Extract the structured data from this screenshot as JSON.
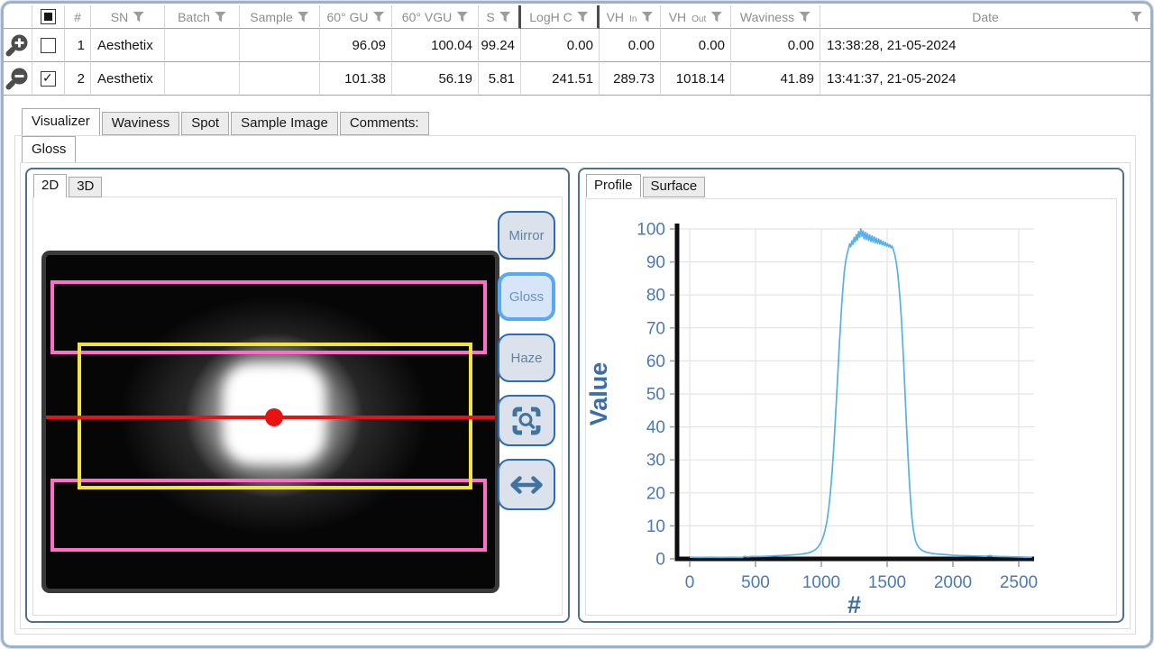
{
  "window": {
    "background": "#ffffff",
    "border_color": "#9db1c9"
  },
  "table": {
    "header_checkbox_state": "indeterminate",
    "columns": [
      {
        "label": ""
      },
      {
        "label": ""
      },
      {
        "label": "#"
      },
      {
        "label": "SN",
        "filter": true
      },
      {
        "label": "Batch",
        "filter": true
      },
      {
        "label": "Sample",
        "filter": true
      },
      {
        "label": "60° GU",
        "filter": true
      },
      {
        "label": "60° VGU",
        "filter": true
      },
      {
        "label": "S",
        "filter": true
      },
      {
        "label": "LogH C",
        "filter": true
      },
      {
        "label": "VH",
        "sub": "In",
        "filter": true
      },
      {
        "label": "VH",
        "sub": "Out",
        "filter": true
      },
      {
        "label": "Waviness",
        "filter": true
      },
      {
        "label": "Date",
        "filter": true
      }
    ],
    "rows": [
      {
        "zoom_icon": "zoom-in",
        "checked": false,
        "num": "1",
        "sn": "Aesthetix",
        "batch": "",
        "sample": "",
        "gu_60": "96.09",
        "vgu_60": "100.04",
        "s": "99.24",
        "logh_c": "0.00",
        "vh_in": "0.00",
        "vh_out": "0.00",
        "waviness": "0.00",
        "date": "13:38:28, 21-05-2024"
      },
      {
        "zoom_icon": "zoom-out",
        "checked": true,
        "num": "2",
        "sn": "Aesthetix",
        "batch": "",
        "sample": "",
        "gu_60": "101.38",
        "vgu_60": "56.19",
        "s": "5.81",
        "logh_c": "241.51",
        "vh_in": "289.73",
        "vh_out": "1018.14",
        "waviness": "41.89",
        "date": "13:41:37, 21-05-2024"
      }
    ]
  },
  "tabs": {
    "main": [
      {
        "label": "Visualizer",
        "active": true
      },
      {
        "label": "Waviness"
      },
      {
        "label": "Spot"
      },
      {
        "label": "Sample Image"
      },
      {
        "label": "Comments:"
      }
    ],
    "sub": [
      {
        "label": "Gloss",
        "active": true
      }
    ],
    "view": [
      {
        "label": "2D",
        "active": true
      },
      {
        "label": "3D"
      }
    ],
    "chart": [
      {
        "label": "Profile",
        "active": true
      },
      {
        "label": "Surface"
      }
    ]
  },
  "visualizer": {
    "buttons": [
      {
        "label": "Mirror"
      },
      {
        "label": "Gloss",
        "active": true
      },
      {
        "label": "Haze"
      }
    ],
    "icon_buttons": [
      {
        "icon": "zoom-fit-icon"
      },
      {
        "icon": "horizontal-arrows-icon"
      }
    ],
    "overlay_colors": {
      "roi_pink": "#ff6ec7",
      "roi_yellow": "#f2e33d",
      "scan_line_red": "#e81212",
      "marker_red": "#e81212"
    }
  },
  "chart_data": {
    "type": "line",
    "title": "",
    "xlabel": "#",
    "ylabel": "Value",
    "xlim": [
      0,
      2650
    ],
    "ylim": [
      0,
      100
    ],
    "xticks": [
      0,
      500,
      1000,
      1500,
      2000,
      2500
    ],
    "yticks": [
      0,
      10,
      20,
      30,
      40,
      50,
      60,
      70,
      80,
      90,
      100
    ],
    "grid": true,
    "legend": false,
    "line_color": "#58b0e9",
    "tick_label_color": "#4a7ab8",
    "axis_label_color": "#3d6da6",
    "series": [
      {
        "name": "Profile",
        "points": [
          [
            0,
            0.5
          ],
          [
            80,
            0.45
          ],
          [
            160,
            0.5
          ],
          [
            240,
            0.45
          ],
          [
            320,
            0.5
          ],
          [
            400,
            0.45
          ],
          [
            415,
            0.75
          ],
          [
            440,
            0.6
          ],
          [
            470,
            0.7
          ],
          [
            500,
            0.7
          ],
          [
            540,
            0.75
          ],
          [
            580,
            0.8
          ],
          [
            620,
            0.85
          ],
          [
            660,
            0.95
          ],
          [
            700,
            1
          ],
          [
            740,
            1.1
          ],
          [
            780,
            1.2
          ],
          [
            820,
            1.3
          ],
          [
            860,
            1.5
          ],
          [
            900,
            1.8
          ],
          [
            930,
            2.2
          ],
          [
            955,
            2.8
          ],
          [
            975,
            3.6
          ],
          [
            995,
            4.8
          ],
          [
            1012,
            6.4
          ],
          [
            1028,
            8.6
          ],
          [
            1043,
            11.5
          ],
          [
            1057,
            15.5
          ],
          [
            1070,
            20.5
          ],
          [
            1082,
            26.5
          ],
          [
            1094,
            33.5
          ],
          [
            1105,
            41
          ],
          [
            1115,
            48.5
          ],
          [
            1125,
            56
          ],
          [
            1135,
            63.5
          ],
          [
            1145,
            70.5
          ],
          [
            1155,
            77
          ],
          [
            1165,
            82.5
          ],
          [
            1175,
            87
          ],
          [
            1185,
            90.2
          ],
          [
            1195,
            92.3
          ],
          [
            1205,
            93.8
          ],
          [
            1215,
            95.5
          ],
          [
            1223,
            94.6
          ],
          [
            1232,
            96.4
          ],
          [
            1240,
            95.3
          ],
          [
            1249,
            97.4
          ],
          [
            1257,
            96.1
          ],
          [
            1266,
            98.3
          ],
          [
            1274,
            96.6
          ],
          [
            1283,
            99.2
          ],
          [
            1291,
            97.4
          ],
          [
            1300,
            100
          ],
          [
            1308,
            97.8
          ],
          [
            1317,
            99.4
          ],
          [
            1325,
            97
          ],
          [
            1334,
            99
          ],
          [
            1342,
            96.8
          ],
          [
            1351,
            98.6
          ],
          [
            1359,
            96.5
          ],
          [
            1368,
            98.2
          ],
          [
            1376,
            96.2
          ],
          [
            1385,
            97.9
          ],
          [
            1393,
            96
          ],
          [
            1402,
            97.6
          ],
          [
            1410,
            95.8
          ],
          [
            1419,
            97.2
          ],
          [
            1427,
            95.6
          ],
          [
            1436,
            96.9
          ],
          [
            1444,
            95.4
          ],
          [
            1453,
            96.6
          ],
          [
            1461,
            95.2
          ],
          [
            1470,
            96.2
          ],
          [
            1478,
            95
          ],
          [
            1487,
            95.9
          ],
          [
            1495,
            94.8
          ],
          [
            1504,
            95.5
          ],
          [
            1512,
            94.6
          ],
          [
            1521,
            95.2
          ],
          [
            1529,
            94.3
          ],
          [
            1538,
            94.8
          ],
          [
            1548,
            93.6
          ],
          [
            1558,
            92.2
          ],
          [
            1568,
            90.2
          ],
          [
            1578,
            87.4
          ],
          [
            1588,
            83.6
          ],
          [
            1598,
            78.8
          ],
          [
            1608,
            72.8
          ],
          [
            1618,
            65.6
          ],
          [
            1628,
            57.4
          ],
          [
            1638,
            48.6
          ],
          [
            1648,
            39.8
          ],
          [
            1658,
            31.6
          ],
          [
            1668,
            24.2
          ],
          [
            1678,
            17.8
          ],
          [
            1688,
            12.8
          ],
          [
            1698,
            9.2
          ],
          [
            1708,
            6.8
          ],
          [
            1718,
            5.2
          ],
          [
            1730,
            4.1
          ],
          [
            1745,
            3.3
          ],
          [
            1760,
            2.7
          ],
          [
            1780,
            2.3
          ],
          [
            1800,
            2
          ],
          [
            1830,
            1.75
          ],
          [
            1860,
            1.55
          ],
          [
            1900,
            1.4
          ],
          [
            1950,
            1.25
          ],
          [
            2000,
            1.1
          ],
          [
            2050,
            1
          ],
          [
            2100,
            0.95
          ],
          [
            2150,
            0.9
          ],
          [
            2200,
            0.85
          ],
          [
            2250,
            0.8
          ],
          [
            2285,
            1
          ],
          [
            2300,
            0.8
          ],
          [
            2350,
            0.72
          ],
          [
            2400,
            0.68
          ],
          [
            2450,
            0.62
          ],
          [
            2500,
            0.58
          ],
          [
            2550,
            0.52
          ],
          [
            2600,
            0.5
          ]
        ]
      }
    ]
  }
}
